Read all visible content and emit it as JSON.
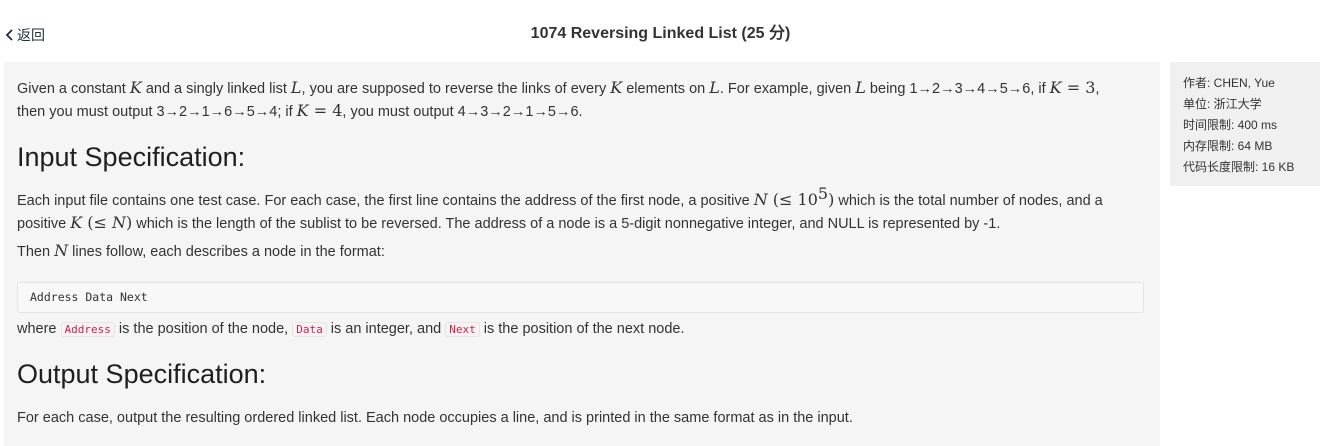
{
  "nav": {
    "back_label": "返回"
  },
  "header": {
    "title": "1074 Reversing Linked List (25 分)"
  },
  "problem": {
    "intro": {
      "s1": "Given a constant ",
      "K": "K",
      "s2": " and a singly linked list ",
      "L": "L",
      "s3": ", you are supposed to reverse the links of every ",
      "s4": " elements on ",
      "s5": ". For example, given ",
      "s6": " being 1→2→3→4→5→6, if ",
      "eq3": " = 3",
      "s7": ",",
      "s8": "then you must output 3→2→1→6→5→4; if ",
      "eq4": " = 4",
      "s9": ", you must output 4→3→2→1→5→6."
    },
    "input_heading": "Input Specification:",
    "input_desc": {
      "s1": "Each input file contains one test case. For each case, the first line contains the address of the first node, a positive ",
      "N": "N",
      "le1": " (≤ 10",
      "exp": "5",
      "le1_close": ")",
      "s2": " which is the total number of nodes, and a",
      "s3": "positive ",
      "le2": " (≤ ",
      "le2_close": ")",
      "s4": " which is the length of the sublist to be reversed. The address of a node is a 5-digit nonnegative integer, and NULL is represented by -1."
    },
    "then_line": {
      "s1": "Then ",
      "s2": " lines follow, each describes a node in the format:"
    },
    "format_code": "Address Data Next",
    "where_line": {
      "s1": "where ",
      "c1": "Address",
      "s2": " is the position of the node, ",
      "c2": "Data",
      "s3": " is an integer, and ",
      "c3": "Next",
      "s4": " is the position of the next node."
    },
    "output_heading": "Output Specification:",
    "output_desc": "For each case, output the resulting ordered linked list. Each node occupies a line, and is printed in the same format as in the input."
  },
  "info": {
    "author": "作者: CHEN, Yue",
    "unit": "单位: 浙江大学",
    "time_limit": "时间限制: 400 ms",
    "memory_limit": "内存限制: 64 MB",
    "code_limit": "代码长度限制: 16 KB"
  },
  "colors": {
    "page_bg": "#ffffff",
    "panel_bg": "#f5f5f5",
    "sidebar_bg": "#f0f0f0",
    "inline_code": "#c7254e"
  }
}
